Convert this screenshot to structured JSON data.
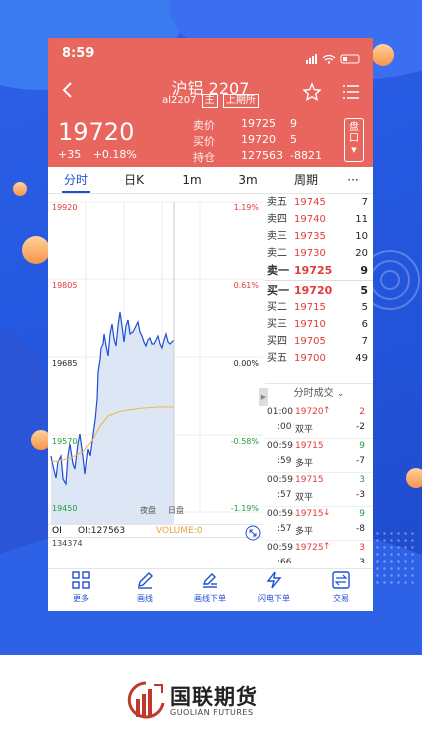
{
  "status_bar": {
    "time": "8:59"
  },
  "header": {
    "title": "沪铝 2207",
    "code": "al2207",
    "tag_main": "主",
    "tag_exchange": "上期所",
    "price": "19720",
    "change": "+35",
    "change_pct": "+0.18%",
    "quote": [
      {
        "label": "卖价",
        "value": "19725",
        "extra": "9"
      },
      {
        "label": "买价",
        "value": "19720",
        "extra": "5"
      },
      {
        "label": "持仓",
        "value": "127563",
        "extra": "-8821"
      }
    ],
    "side_button": "盘口"
  },
  "tabs": [
    "分时",
    "日K",
    "1m",
    "3m",
    "周期",
    "···"
  ],
  "chart": {
    "y_labels": [
      "19920",
      "19805",
      "19685",
      "19570",
      "19450"
    ],
    "pct_labels": [
      "1.19%",
      "0.61%",
      "0.00%",
      "-0.58%",
      "-1.19%"
    ],
    "session_labels": [
      "夜盘",
      "日盘"
    ],
    "oi_label": "OI",
    "oi_value": "OI:127563",
    "volume_label": "VOLUME:0",
    "volume_value": "134374"
  },
  "order_book": [
    {
      "label": "卖五",
      "price": "19745",
      "qty": "7"
    },
    {
      "label": "卖四",
      "price": "19740",
      "qty": "11"
    },
    {
      "label": "卖三",
      "price": "19735",
      "qty": "10"
    },
    {
      "label": "卖二",
      "price": "19730",
      "qty": "20"
    },
    {
      "label": "卖一",
      "price": "19725",
      "qty": "9"
    },
    {
      "label": "买一",
      "price": "19720",
      "qty": "5"
    },
    {
      "label": "买二",
      "price": "19715",
      "qty": "5"
    },
    {
      "label": "买三",
      "price": "19710",
      "qty": "6"
    },
    {
      "label": "买四",
      "price": "19705",
      "qty": "7"
    },
    {
      "label": "买五",
      "price": "19700",
      "qty": "49"
    }
  ],
  "trades_title": "分时成交",
  "trades": [
    {
      "time1": "01:00",
      "time2": ":00",
      "price": "19720",
      "arrow": "↑",
      "v1": "2",
      "type": "双平",
      "v2": "-2"
    },
    {
      "time1": "00:59",
      "time2": ":59",
      "price": "19715",
      "arrow": "",
      "v1": "9",
      "type": "多平",
      "v2": "-7"
    },
    {
      "time1": "00:59",
      "time2": ":57",
      "price": "19715",
      "arrow": "",
      "v1": "3",
      "type": "双平",
      "v2": "-3"
    },
    {
      "time1": "00:59",
      "time2": ":57",
      "price": "19715",
      "arrow": "↓",
      "v1": "9",
      "type": "多平",
      "v2": "-8"
    },
    {
      "time1": "00:59",
      "time2": ":66",
      "price": "19725",
      "arrow": "↑",
      "v1": "3",
      "type": "",
      "v2": "3"
    }
  ],
  "nav": [
    "更多",
    "画线",
    "画线下单",
    "闪电下单",
    "交易"
  ],
  "brand": {
    "name": "国联期货",
    "english": "GUOLIAN FUTURES"
  },
  "colors": {
    "header": "#e8665d",
    "up": "#e23b3b",
    "down": "#1e9e3a",
    "accent": "#1f4fd3",
    "background": "#2458e0"
  }
}
